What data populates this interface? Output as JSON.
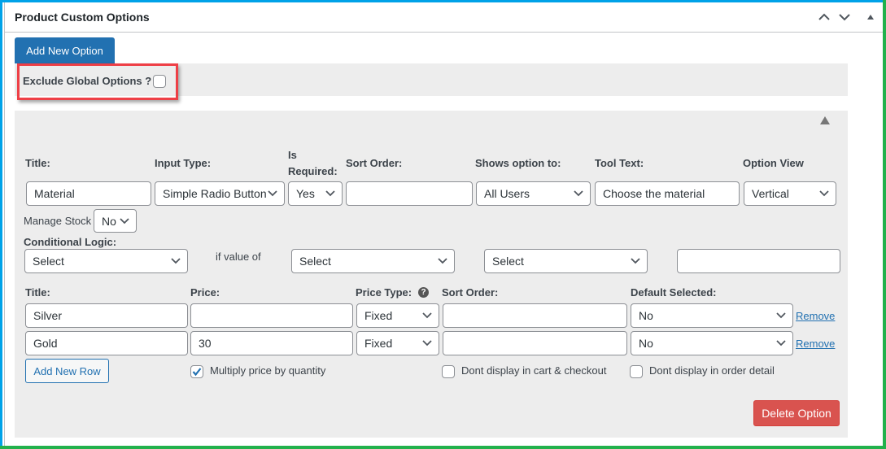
{
  "colors": {
    "frame_top_left": "#00a2e8",
    "frame_bottom_right": "#22b14c",
    "primary": "#2271b1",
    "danger": "#d9534f",
    "highlight": "#ee3f46",
    "panel_bg": "#ededed"
  },
  "header": {
    "title": "Product Custom Options",
    "icons": [
      "chevron-up-icon",
      "chevron-down-icon",
      "triangle-up-icon"
    ]
  },
  "toolbar": {
    "add_option_label": "Add New Option"
  },
  "exclude": {
    "label": "Exclude Global Options ?",
    "checked": false
  },
  "option": {
    "collapse_icon": "triangle-up-icon",
    "labels": {
      "title": "Title:",
      "input_type": "Input Type:",
      "is_required_1": "Is",
      "is_required_2": "Required:",
      "sort_order": "Sort Order:",
      "shows_option_to": "Shows option to:",
      "tool_text": "Tool Text:",
      "option_view": "Option View",
      "manage_stock": "Manage Stock",
      "conditional_logic": "Conditional Logic:",
      "if_value_of": "if value of"
    },
    "values": {
      "title": "Material",
      "input_type": "Simple Radio Button",
      "is_required": "Yes",
      "sort_order": "",
      "shows_option_to": "All Users",
      "tool_text": "Choose the material",
      "option_view": "Vertical",
      "manage_stock": "No",
      "conditional_select_1": "Select",
      "conditional_select_2": "Select",
      "conditional_select_3": "Select",
      "conditional_value": ""
    },
    "rows_header": {
      "title": "Title:",
      "price": "Price:",
      "price_type": "Price Type:",
      "sort_order": "Sort Order:",
      "default_selected": "Default Selected:"
    },
    "rows": [
      {
        "title": "Silver",
        "price": "",
        "price_type": "Fixed",
        "sort_order": "",
        "default_selected": "No",
        "remove_label": "Remove"
      },
      {
        "title": "Gold",
        "price": "30",
        "price_type": "Fixed",
        "sort_order": "",
        "default_selected": "No",
        "remove_label": "Remove"
      }
    ],
    "add_row_label": "Add New Row",
    "multiply_price": {
      "label": "Multiply price by quantity",
      "checked": true
    },
    "dont_display_cart": {
      "label": "Dont display in cart & checkout",
      "checked": false
    },
    "dont_display_order": {
      "label": "Dont display in order detail",
      "checked": false
    },
    "delete_label": "Delete Option"
  }
}
